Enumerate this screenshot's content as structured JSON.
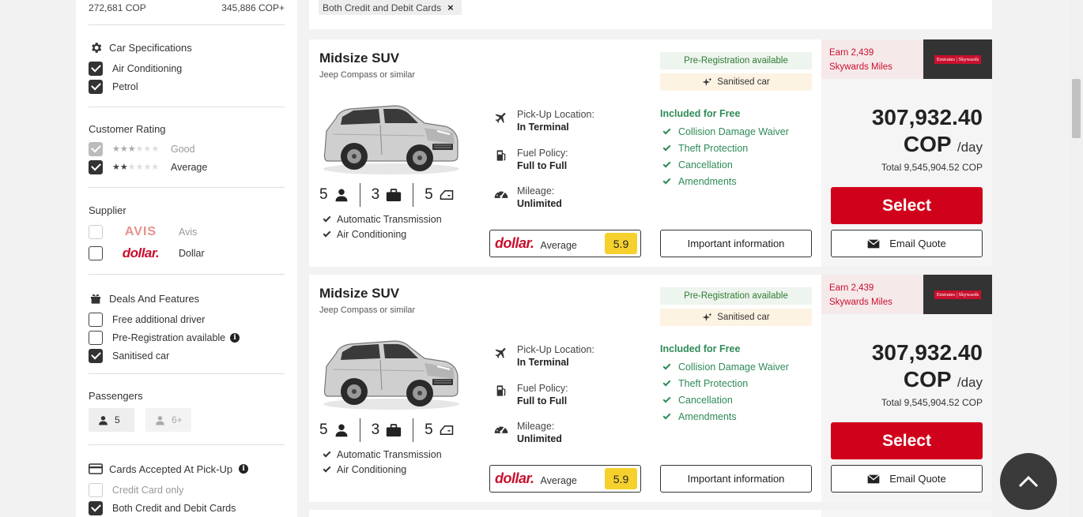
{
  "sidebar": {
    "price_min": "272,681 COP",
    "price_max": "345,886 COP+",
    "car_specs": {
      "title": "Car Specifications",
      "items": [
        {
          "label": "Air Conditioning",
          "checked": true
        },
        {
          "label": "Petrol",
          "checked": true
        }
      ]
    },
    "rating": {
      "title": "Customer Rating",
      "items": [
        {
          "label": "Good",
          "stars": 3,
          "checked": true,
          "disabled": true
        },
        {
          "label": "Average",
          "stars": 2,
          "checked": true,
          "disabled": false
        }
      ]
    },
    "supplier": {
      "title": "Supplier",
      "items": [
        {
          "logo": "AVIS",
          "label": "Avis",
          "checked": false,
          "disabled": true
        },
        {
          "logo": "dollar.",
          "label": "Dollar",
          "checked": false,
          "disabled": false
        }
      ]
    },
    "deals": {
      "title": "Deals And Features",
      "items": [
        {
          "label": "Free additional driver",
          "checked": false
        },
        {
          "label": "Pre-Registration available",
          "checked": false
        },
        {
          "label": "Sanitised car",
          "checked": true
        }
      ]
    },
    "passengers": {
      "title": "Passengers",
      "options": [
        "5",
        "6+"
      ]
    },
    "cards": {
      "title": "Cards Accepted At Pick-Up",
      "items": [
        {
          "label": "Credit Card only",
          "checked": false,
          "disabled": true
        },
        {
          "label": "Both Credit and Debit Cards",
          "checked": true,
          "disabled": false
        }
      ]
    }
  },
  "filter_tag": {
    "label": "Both Credit and Debit Cards",
    "close": "×"
  },
  "cards": [
    {
      "title": "Midsize SUV",
      "subtitle": "Jeep Compass or similar",
      "seats": "5",
      "bags": "3",
      "doors": "5",
      "features": [
        "Automatic Transmission",
        "Air Conditioning"
      ],
      "pickup_label": "Pick-Up Location:",
      "pickup_value": "In Terminal",
      "fuel_label": "Fuel Policy:",
      "fuel_value": "Full to Full",
      "mileage_label": "Mileage:",
      "mileage_value": "Unlimited",
      "supplier_logo": "dollar.",
      "supplier_rating_label": "Average",
      "supplier_score": "5.9",
      "prereg": "Pre-Registration available",
      "sanitised": "Sanitised car",
      "included_title": "Included for Free",
      "included": [
        "Collision Damage Waiver",
        "Theft Protection",
        "Cancellation",
        "Amendments"
      ],
      "important_info": "Important information",
      "earn_text": "Earn 2,439 Skywards Miles",
      "partner_logo": "Emirates | Skywards",
      "price_amount": "307,932.40",
      "price_currency": "COP",
      "price_per": "/day",
      "total": "Total 9,545,904.52 COP",
      "select_label": "Select",
      "email_label": "Email Quote"
    },
    {
      "title": "Midsize SUV",
      "subtitle": "Jeep Compass or similar",
      "seats": "5",
      "bags": "3",
      "doors": "5",
      "features": [
        "Automatic Transmission",
        "Air Conditioning"
      ],
      "pickup_label": "Pick-Up Location:",
      "pickup_value": "In Terminal",
      "fuel_label": "Fuel Policy:",
      "fuel_value": "Full to Full",
      "mileage_label": "Mileage:",
      "mileage_value": "Unlimited",
      "supplier_logo": "dollar.",
      "supplier_rating_label": "Average",
      "supplier_score": "5.9",
      "prereg": "Pre-Registration available",
      "sanitised": "Sanitised car",
      "included_title": "Included for Free",
      "included": [
        "Collision Damage Waiver",
        "Theft Protection",
        "Cancellation",
        "Amendments"
      ],
      "important_info": "Important information",
      "earn_text": "Earn 2,439 Skywards Miles",
      "partner_logo": "Emirates | Skywards",
      "price_amount": "307,932.40",
      "price_currency": "COP",
      "price_per": "/day",
      "total": "Total 9,545,904.52 COP",
      "select_label": "Select",
      "email_label": "Email Quote"
    }
  ],
  "colors": {
    "accent_red": "#d0021b",
    "included_green": "#2e8b57",
    "score_yellow": "#f6d12e"
  }
}
